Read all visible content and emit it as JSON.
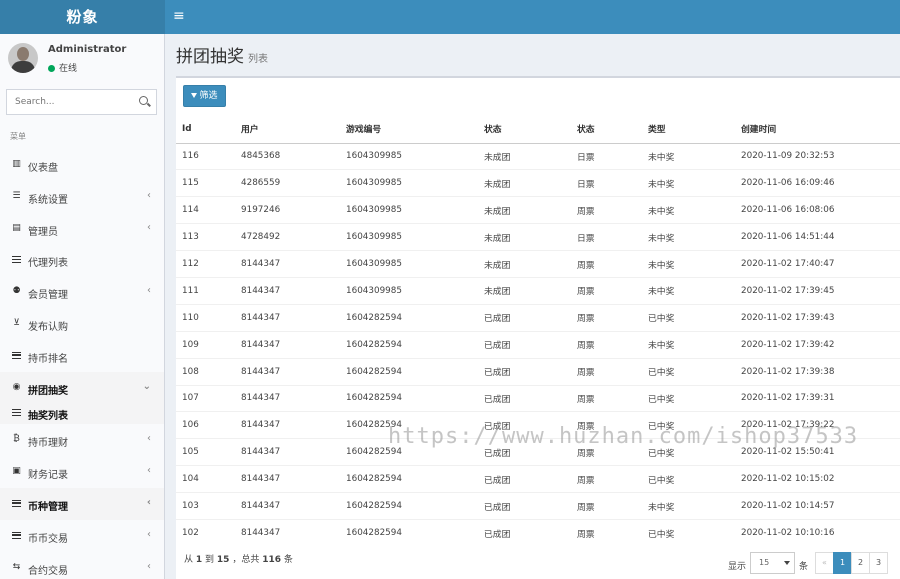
{
  "header": {
    "logo": "粉象",
    "toggle_glyph": "≡"
  },
  "user_panel": {
    "name": "Administrator",
    "status": "在线",
    "status_color": "#00a65a"
  },
  "search": {
    "placeholder": "Search..."
  },
  "menu": {
    "header": "菜单",
    "items": [
      {
        "label": "仪表盘",
        "icon": "bar-chart-icon",
        "glyph": "▥",
        "chevron": ""
      },
      {
        "label": "系统设置",
        "icon": "sliders-icon",
        "glyph": "☰",
        "chevron": "‹"
      },
      {
        "label": "管理员",
        "icon": "id-card-icon",
        "glyph": "▤",
        "chevron": "‹"
      },
      {
        "label": "代理列表",
        "icon": "list-icon",
        "glyph": "",
        "chevron": ""
      },
      {
        "label": "会员管理",
        "icon": "users-icon",
        "glyph": "⚉",
        "chevron": "‹"
      },
      {
        "label": "发布认购",
        "icon": "cart-icon",
        "glyph": "⊻",
        "chevron": ""
      },
      {
        "label": "持币排名",
        "icon": "list-icon",
        "glyph": "",
        "chevron": ""
      },
      {
        "label": "拼团抽奖",
        "icon": "dashboard-icon",
        "glyph": "◉",
        "chevron": "⌄"
      },
      {
        "label": "抽奖列表",
        "icon": "list-icon",
        "glyph": "",
        "chevron": ""
      },
      {
        "label": "持币理财",
        "icon": "bitcoin-icon",
        "glyph": "₿",
        "chevron": "‹"
      },
      {
        "label": "财务记录",
        "icon": "money-icon",
        "glyph": "▣",
        "chevron": "‹"
      },
      {
        "label": "币种管理",
        "icon": "list-icon",
        "glyph": "",
        "chevron": "‹"
      },
      {
        "label": "币币交易",
        "icon": "list-icon",
        "glyph": "",
        "chevron": "‹"
      },
      {
        "label": "合约交易",
        "icon": "exchange-icon",
        "glyph": "⇆",
        "chevron": "‹"
      }
    ]
  },
  "page": {
    "title": "拼团抽奖",
    "subtitle": "列表"
  },
  "toolbar": {
    "filter_label": "筛选"
  },
  "table": {
    "headers": [
      "Id",
      "用户",
      "游戏编号",
      "状态",
      "状态",
      "类型",
      "创建时间"
    ],
    "rows": [
      [
        "116",
        "4845368",
        "1604309985",
        "未成团",
        "日票",
        "未中奖",
        "2020-11-09 20:32:53"
      ],
      [
        "115",
        "4286559",
        "1604309985",
        "未成团",
        "日票",
        "未中奖",
        "2020-11-06 16:09:46"
      ],
      [
        "114",
        "9197246",
        "1604309985",
        "未成团",
        "周票",
        "未中奖",
        "2020-11-06 16:08:06"
      ],
      [
        "113",
        "4728492",
        "1604309985",
        "未成团",
        "日票",
        "未中奖",
        "2020-11-06 14:51:44"
      ],
      [
        "112",
        "8144347",
        "1604309985",
        "未成团",
        "周票",
        "未中奖",
        "2020-11-02 17:40:47"
      ],
      [
        "111",
        "8144347",
        "1604309985",
        "未成团",
        "周票",
        "未中奖",
        "2020-11-02 17:39:45"
      ],
      [
        "110",
        "8144347",
        "1604282594",
        "已成团",
        "周票",
        "已中奖",
        "2020-11-02 17:39:43"
      ],
      [
        "109",
        "8144347",
        "1604282594",
        "已成团",
        "周票",
        "未中奖",
        "2020-11-02 17:39:42"
      ],
      [
        "108",
        "8144347",
        "1604282594",
        "已成团",
        "周票",
        "已中奖",
        "2020-11-02 17:39:38"
      ],
      [
        "107",
        "8144347",
        "1604282594",
        "已成团",
        "周票",
        "已中奖",
        "2020-11-02 17:39:31"
      ],
      [
        "106",
        "8144347",
        "1604282594",
        "已成团",
        "周票",
        "已中奖",
        "2020-11-02 17:39:22"
      ],
      [
        "105",
        "8144347",
        "1604282594",
        "已成团",
        "周票",
        "已中奖",
        "2020-11-02 15:50:41"
      ],
      [
        "104",
        "8144347",
        "1604282594",
        "已成团",
        "周票",
        "已中奖",
        "2020-11-02 10:15:02"
      ],
      [
        "103",
        "8144347",
        "1604282594",
        "已成团",
        "周票",
        "未中奖",
        "2020-11-02 10:14:57"
      ],
      [
        "102",
        "8144347",
        "1604282594",
        "已成团",
        "周票",
        "已中奖",
        "2020-11-02 10:10:16"
      ]
    ]
  },
  "footer": {
    "info_prefix": "从",
    "from": "1",
    "info_mid1": "到",
    "to": "15",
    "info_mid2": "，总共",
    "total": "116",
    "info_suffix": "条",
    "show_label": "显示",
    "page_size": "15",
    "page_unit": "条",
    "pages": [
      "«",
      "1",
      "2",
      "3"
    ],
    "current_page": "1"
  },
  "watermark": "https://www.huzhan.com/ishop37533",
  "colors": {
    "accent": "#3c8dbc",
    "topbar": "#3c8dbc",
    "logo_bg": "#367fa9"
  }
}
